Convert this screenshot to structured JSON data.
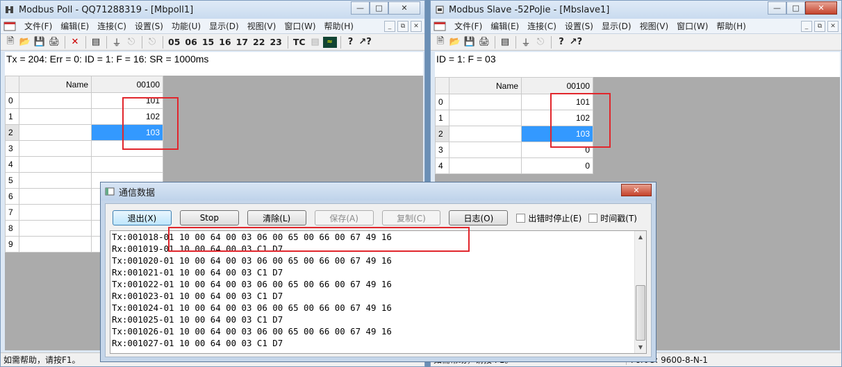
{
  "left_window": {
    "title": "Modbus Poll - QQ71288319 - [Mbpoll1]",
    "menus": [
      "文件(F)",
      "编辑(E)",
      "连接(C)",
      "设置(S)",
      "功能(U)",
      "显示(D)",
      "视图(V)",
      "窗口(W)",
      "帮助(H)"
    ],
    "toolbar_codes": [
      "05",
      "06",
      "15",
      "16",
      "17",
      "22",
      "23"
    ],
    "toolbar_tc": "TC",
    "status_line": "Tx = 204: Err = 0: ID = 1: F = 16: SR = 1000ms",
    "grid": {
      "name_header": "Name",
      "col_header": "00100",
      "rows": [
        {
          "idx": "0",
          "value": "101"
        },
        {
          "idx": "1",
          "value": "102"
        },
        {
          "idx": "2",
          "value": "103"
        },
        {
          "idx": "3",
          "value": ""
        },
        {
          "idx": "4",
          "value": ""
        },
        {
          "idx": "5",
          "value": ""
        },
        {
          "idx": "6",
          "value": ""
        },
        {
          "idx": "7",
          "value": ""
        },
        {
          "idx": "8",
          "value": ""
        },
        {
          "idx": "9",
          "value": ""
        }
      ]
    },
    "statusbar": "如需帮助，请按F1。"
  },
  "right_window": {
    "title": "Modbus Slave -52PoJie - [Mbslave1]",
    "menus": [
      "文件(F)",
      "编辑(E)",
      "连接(C)",
      "设置(S)",
      "显示(D)",
      "视图(V)",
      "窗口(W)",
      "帮助(H)"
    ],
    "status_line": "ID = 1: F = 03",
    "grid": {
      "name_header": "Name",
      "col_header": "00100",
      "rows": [
        {
          "idx": "0",
          "value": "101"
        },
        {
          "idx": "1",
          "value": "102"
        },
        {
          "idx": "2",
          "value": "103"
        },
        {
          "idx": "3",
          "value": "0"
        },
        {
          "idx": "4",
          "value": "0"
        }
      ]
    },
    "statusbar_left": "如需帮助，请按 F1。",
    "statusbar_right": "Port 3: 9600-8-N-1"
  },
  "dialog": {
    "title": "通信数据",
    "buttons": {
      "exit": "退出(X)",
      "stop": "Stop",
      "clear": "清除(L)",
      "save": "保存(A)",
      "copy": "复制(C)",
      "log": "日志(O)"
    },
    "checkboxes": {
      "stop_on_error": "出错时停止(E)",
      "timestamp": "时间戳(T)"
    },
    "log_lines": [
      "Tx:001018-01 10 00 64 00 03 06 00 65 00 66 00 67 49 16",
      "Rx:001019-01 10 00 64 00 03 C1 D7",
      "Tx:001020-01 10 00 64 00 03 06 00 65 00 66 00 67 49 16",
      "Rx:001021-01 10 00 64 00 03 C1 D7",
      "Tx:001022-01 10 00 64 00 03 06 00 65 00 66 00 67 49 16",
      "Rx:001023-01 10 00 64 00 03 C1 D7",
      "Tx:001024-01 10 00 64 00 03 06 00 65 00 66 00 67 49 16",
      "Rx:001025-01 10 00 64 00 03 C1 D7",
      "Tx:001026-01 10 00 64 00 03 06 00 65 00 66 00 67 49 16",
      "Rx:001027-01 10 00 64 00 03 C1 D7"
    ]
  },
  "colors": {
    "selection": "#3399ff",
    "highlight_box": "#e1262c"
  }
}
